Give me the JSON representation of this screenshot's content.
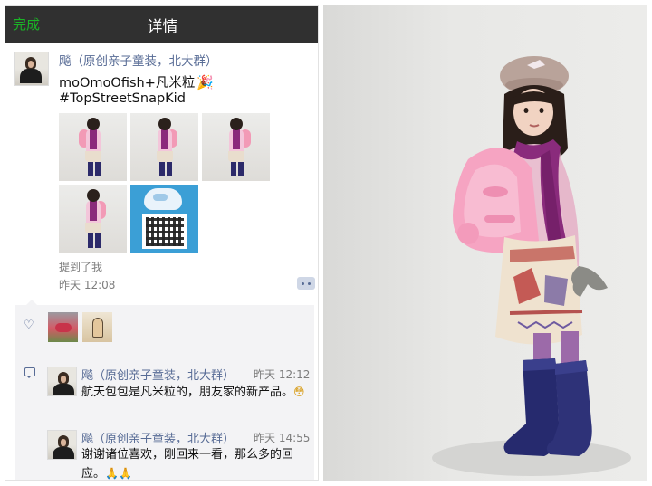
{
  "nav": {
    "done_label": "完成",
    "title": "详情"
  },
  "post": {
    "author": "飚（原创亲子童装，北大群）",
    "line1": "moOmoOfish+凡米粒",
    "line1_emoji": "🎉",
    "line2": "#TopStreetSnapKid",
    "mentioned": "提到了我",
    "time": "昨天 12:08"
  },
  "likes": {
    "icon": "heart-icon",
    "avatars": [
      "like-avatar-1",
      "like-avatar-2"
    ]
  },
  "comments": [
    {
      "author": "飚（原创亲子童装，北大群）",
      "time": "昨天 12:12",
      "text": "航天包包是凡米粒的，朋友家的新产品。",
      "emoji": "😳"
    },
    {
      "author": "飚（原创亲子童装，北大群）",
      "time": "昨天 14:55",
      "text": "谢谢诸位喜欢，刚回来一看，那么多的回应。",
      "emoji": "🙏🙏"
    }
  ],
  "colors": {
    "accent_green": "#1ab526",
    "link_blue": "#576b95",
    "navbar": "#303030"
  }
}
